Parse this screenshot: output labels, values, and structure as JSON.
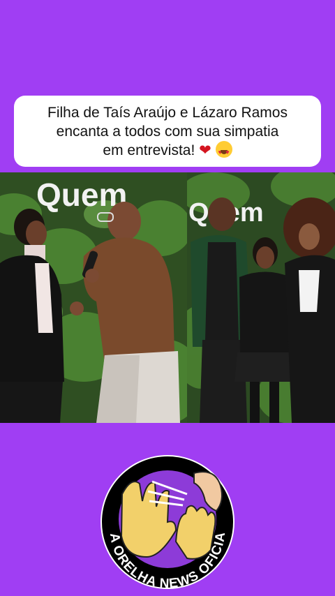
{
  "caption": {
    "line1": "Filha de Taís Araújo e Lázaro Ramos",
    "line2": "encanta a todos com sua simpatia",
    "line3": "em entrevista!",
    "emoji_heart": "❤️",
    "emoji_face": "heart-eyes-face-icon"
  },
  "photos": {
    "left_sign": "Quem",
    "right_sign": "Quem"
  },
  "logo": {
    "text": "NA ORELHA NEWS OFICIAL"
  },
  "colors": {
    "background": "#a03ef3",
    "card": "#ffffff",
    "foliage": "#3f6b2a"
  }
}
